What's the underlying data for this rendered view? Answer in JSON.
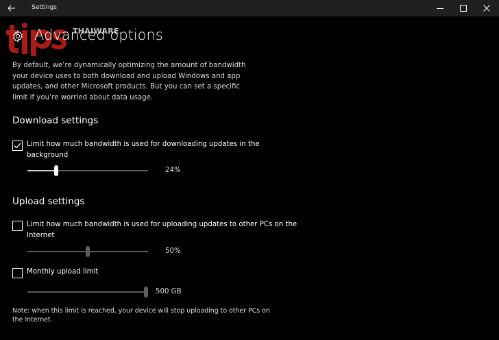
{
  "window": {
    "title": "Settings"
  },
  "watermark": {
    "brand": "THAIWARE",
    "logo_text": "tips"
  },
  "header": {
    "icon": "gear-icon",
    "title": "Advanced options"
  },
  "description": "By default, we’re dynamically optimizing the amount of bandwidth your device uses to both download and upload Windows and app updates, and other Microsoft products. But you can set a specific limit if you’re worried about data usage.",
  "download": {
    "section_title": "Download settings",
    "limit_checkbox": {
      "label": "Limit how much bandwidth is used for downloading updates in the background",
      "checked": true
    },
    "slider": {
      "percent": 24,
      "label": "24%"
    }
  },
  "upload": {
    "section_title": "Upload settings",
    "limit_checkbox": {
      "label": "Limit how much bandwidth is used for uploading updates to other PCs on the Internet",
      "checked": false
    },
    "slider": {
      "percent": 50,
      "label": "50%"
    },
    "monthly_checkbox": {
      "label": "Monthly upload limit",
      "checked": false
    },
    "monthly_slider": {
      "value_gb": 500,
      "label": "500 GB"
    },
    "note": "Note: when this limit is reached, your device will stop uploading to other PCs on the Internet."
  },
  "colors": {
    "background": "#000000",
    "titlebar": "#1f1f1f",
    "text": "#ffffff",
    "watermark_red": "#d9251c"
  }
}
